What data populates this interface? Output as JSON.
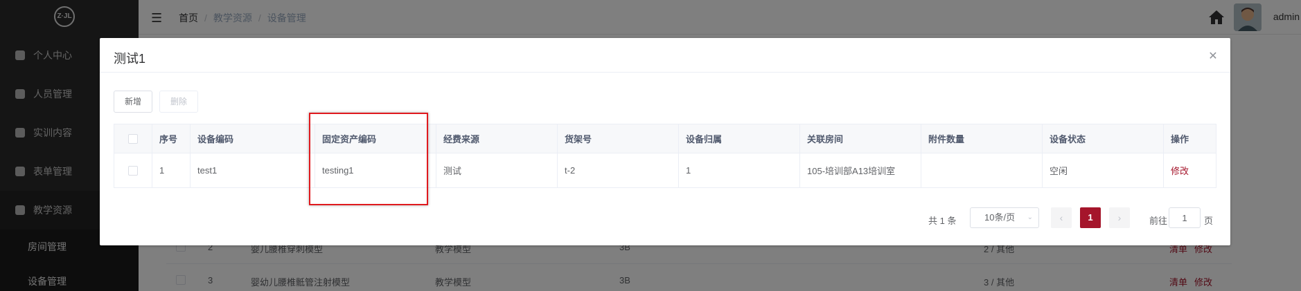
{
  "sidebar": {
    "logo_text": "Z·JL",
    "items": [
      {
        "label": "个人中心",
        "icon": "user-icon"
      },
      {
        "label": "人员管理",
        "icon": "users-icon"
      },
      {
        "label": "实训内容",
        "icon": "book-icon"
      },
      {
        "label": "表单管理",
        "icon": "form-icon"
      },
      {
        "label": "教学资源",
        "icon": "resource-icon"
      }
    ],
    "sub_items": [
      {
        "label": "房间管理"
      },
      {
        "label": "设备管理"
      }
    ]
  },
  "header": {
    "breadcrumb": [
      "首页",
      "教学资源",
      "设备管理"
    ],
    "user_name": "admin"
  },
  "background_table": {
    "rows": [
      {
        "index": "2",
        "name": "婴儿腰椎穿刺模型",
        "type": "教学模型",
        "brand": "3B",
        "category": "2 / 其他",
        "actions": [
          "清单",
          "修改"
        ]
      },
      {
        "index": "3",
        "name": "婴幼儿腰椎骶管注射模型",
        "type": "教学模型",
        "brand": "3B",
        "category": "3 / 其他",
        "actions": [
          "清单",
          "修改"
        ]
      }
    ]
  },
  "dialog": {
    "title": "测试1",
    "add_label": "新增",
    "delete_label": "删除",
    "columns": [
      "序号",
      "设备编码",
      "固定资产编码",
      "经费来源",
      "货架号",
      "设备归属",
      "关联房间",
      "附件数量",
      "设备状态",
      "操作"
    ],
    "rows": [
      {
        "index": "1",
        "device_code": "test1",
        "asset_code": "testing1",
        "funding": "测试",
        "shelf": "t-2",
        "owner": "1",
        "room": "105-培训部A13培训室",
        "attachments": "",
        "status": "空闲",
        "action": "修改"
      }
    ],
    "pagination": {
      "total_text": "共 1 条",
      "page_size": "10条/页",
      "current_page": "1",
      "goto_label": "前往",
      "goto_value": "1",
      "page_suffix": "页"
    }
  },
  "colors": {
    "accent": "#a5152b",
    "highlight_box": "#e0191e"
  }
}
